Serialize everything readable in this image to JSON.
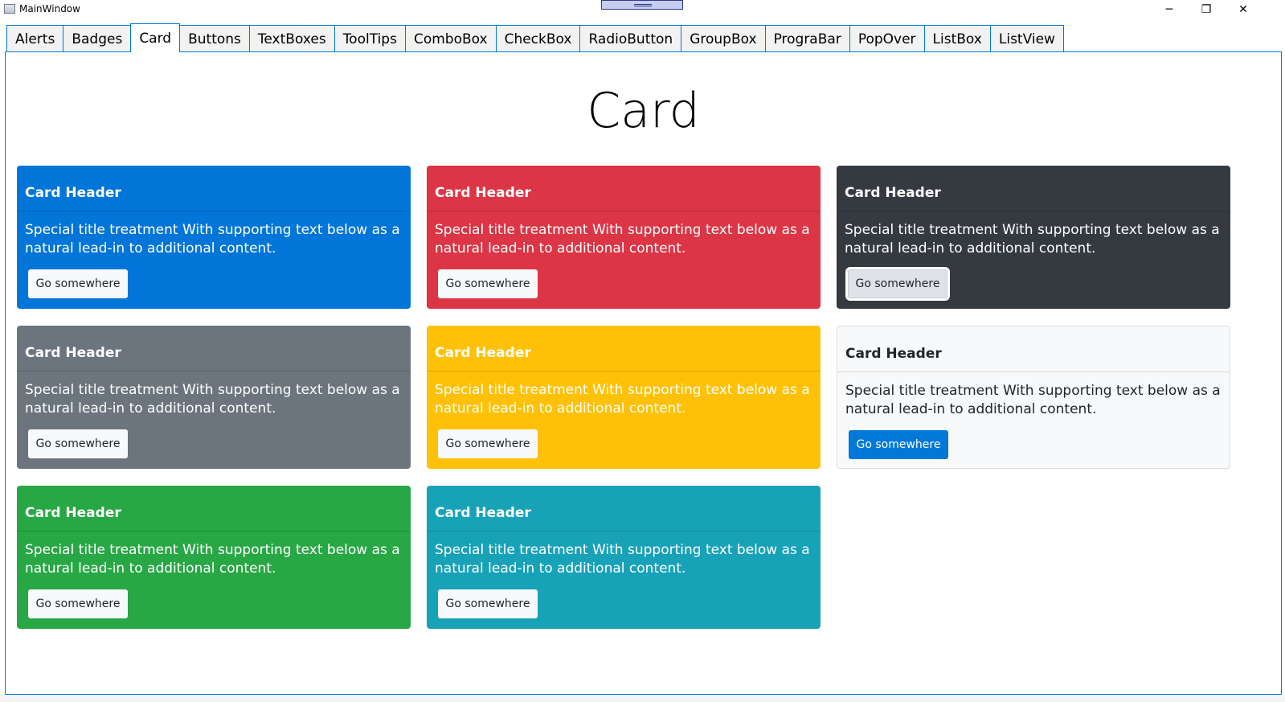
{
  "window": {
    "title": "MainWindow",
    "minimize_glyph": "─",
    "maximize_glyph": "❐",
    "close_glyph": "✕"
  },
  "tabs": [
    {
      "label": "Alerts"
    },
    {
      "label": "Badges"
    },
    {
      "label": "Card"
    },
    {
      "label": "Buttons"
    },
    {
      "label": "TextBoxes"
    },
    {
      "label": "ToolTips"
    },
    {
      "label": "ComboBox"
    },
    {
      "label": "CheckBox"
    },
    {
      "label": "RadioButton"
    },
    {
      "label": "GroupBox"
    },
    {
      "label": "PrograBar"
    },
    {
      "label": "PopOver"
    },
    {
      "label": "ListBox"
    },
    {
      "label": "ListView"
    }
  ],
  "active_tab": "Card",
  "page": {
    "title": "Card"
  },
  "cards": [
    {
      "variant": "primary",
      "bg": "#0275d8",
      "header": "Card Header",
      "body": "Special title treatment With supporting text below as a natural lead-in to additional content.",
      "button": "Go somewhere"
    },
    {
      "variant": "danger",
      "bg": "#dc3545",
      "header": "Card Header",
      "body": "Special title treatment With supporting text below as a natural lead-in to additional content.",
      "button": "Go somewhere"
    },
    {
      "variant": "dark",
      "bg": "#343a40",
      "header": "Card Header",
      "body": "Special title treatment With supporting text below as a natural lead-in to additional content.",
      "button": "Go somewhere"
    },
    {
      "variant": "secondary",
      "bg": "#6c757d",
      "header": "Card Header",
      "body": "Special title treatment With supporting text below as a natural lead-in to additional content.",
      "button": "Go somewhere"
    },
    {
      "variant": "warning",
      "bg": "#ffc107",
      "header": "Card Header",
      "body": "Special title treatment With supporting text below as a natural lead-in to additional content.",
      "button": "Go somewhere"
    },
    {
      "variant": "light",
      "bg": "#f8f9fa",
      "header": "Card Header",
      "body": "Special title treatment With supporting text below as a natural lead-in to additional content.",
      "button": "Go somewhere"
    },
    {
      "variant": "success",
      "bg": "#28a745",
      "header": "Card Header",
      "body": "Special title treatment With supporting text below as a natural lead-in to additional content.",
      "button": "Go somewhere"
    },
    {
      "variant": "info",
      "bg": "#17a2b8",
      "header": "Card Header",
      "body": "Special title treatment With supporting text below as a natural lead-in to additional content.",
      "button": "Go somewhere"
    }
  ]
}
